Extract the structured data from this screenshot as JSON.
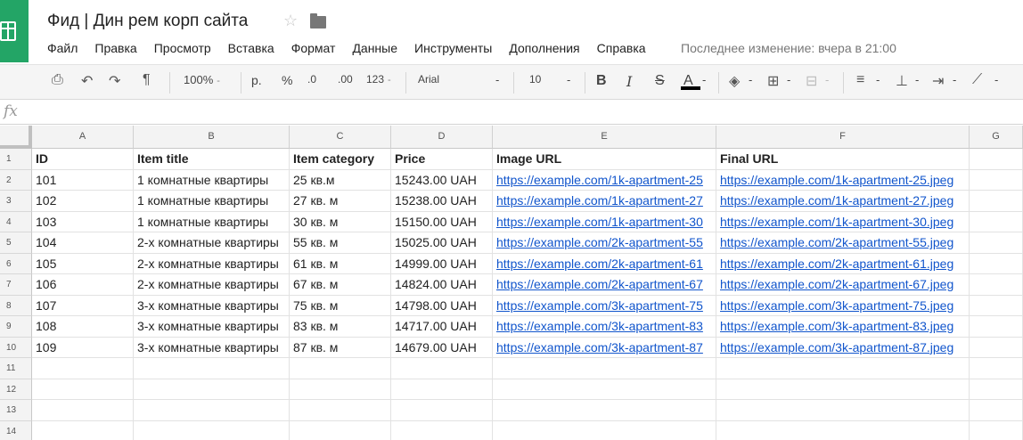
{
  "app": {
    "doc_title": "Фид | Дин рем корп сайта",
    "last_edit": "Последнее изменение: вчера в 21:00"
  },
  "menu": [
    "Файл",
    "Правка",
    "Просмотр",
    "Вставка",
    "Формат",
    "Данные",
    "Инструменты",
    "Дополнения",
    "Справка"
  ],
  "toolbar": {
    "zoom": "100%",
    "currency": "р.",
    "percent": "%",
    "dec_less": ".0",
    "dec_more": ".00",
    "format_more": "123",
    "font": "Arial",
    "font_size": "10",
    "bold": "B",
    "italic": "I",
    "strike": "S",
    "text_color": "A"
  },
  "formula_bar": {
    "fx": "fx",
    "value": ""
  },
  "columns": [
    "A",
    "B",
    "C",
    "D",
    "E",
    "F",
    "G"
  ],
  "row_numbers": [
    "1",
    "2",
    "3",
    "4",
    "5",
    "6",
    "7",
    "8",
    "9",
    "10",
    "11",
    "12",
    "13",
    "14"
  ],
  "header_row": [
    "ID",
    "Item title",
    "Item category",
    "Price",
    "Image URL",
    "Final URL"
  ],
  "rows": [
    [
      "101",
      "1 комнатные квартиры",
      "25 кв.м",
      "15243.00 UAH",
      "https://example.com/1k-apartment-25",
      "https://example.com/1k-apartment-25.jpeg"
    ],
    [
      "102",
      "1 комнатные квартиры",
      "27 кв. м",
      "15238.00 UAH",
      "https://example.com/1k-apartment-27",
      "https://example.com/1k-apartment-27.jpeg"
    ],
    [
      "103",
      "1 комнатные квартиры",
      "30 кв. м",
      "15150.00 UAH",
      "https://example.com/1k-apartment-30",
      "https://example.com/1k-apartment-30.jpeg"
    ],
    [
      "104",
      "2-х комнатные квартиры",
      "55 кв. м",
      "15025.00 UAH",
      "https://example.com/2k-apartment-55",
      "https://example.com/2k-apartment-55.jpeg"
    ],
    [
      "105",
      "2-х комнатные квартиры",
      "61 кв. м",
      "14999.00 UAH",
      "https://example.com/2k-apartment-61",
      "https://example.com/2k-apartment-61.jpeg"
    ],
    [
      "106",
      "2-х комнатные квартиры",
      "67 кв. м",
      "14824.00 UAH",
      "https://example.com/2k-apartment-67",
      "https://example.com/2k-apartment-67.jpeg"
    ],
    [
      "107",
      "3-х комнатные квартиры",
      "75 кв. м",
      "14798.00 UAH",
      "https://example.com/3k-apartment-75",
      "https://example.com/3k-apartment-75.jpeg"
    ],
    [
      "108",
      "3-х комнатные квартиры",
      "83 кв. м",
      "14717.00 UAH",
      "https://example.com/3k-apartment-83",
      "https://example.com/3k-apartment-83.jpeg"
    ],
    [
      "109",
      "3-х комнатные квартиры",
      "87 кв. м",
      "14679.00 UAH",
      "https://example.com/3k-apartment-87",
      "https://example.com/3k-apartment-87.jpeg"
    ]
  ],
  "colors": {
    "brand": "#23a566",
    "link": "#1155cc",
    "header_bg": "#f3f3f3"
  },
  "icons": [
    "sheets-logo-icon",
    "star-icon",
    "folder-icon",
    "print-icon",
    "undo-icon",
    "redo-icon",
    "paint-format-icon",
    "fill-color-icon",
    "borders-icon",
    "merge-icon",
    "align-left-icon",
    "valign-bottom-icon",
    "wrap-icon",
    "rotate-icon"
  ]
}
